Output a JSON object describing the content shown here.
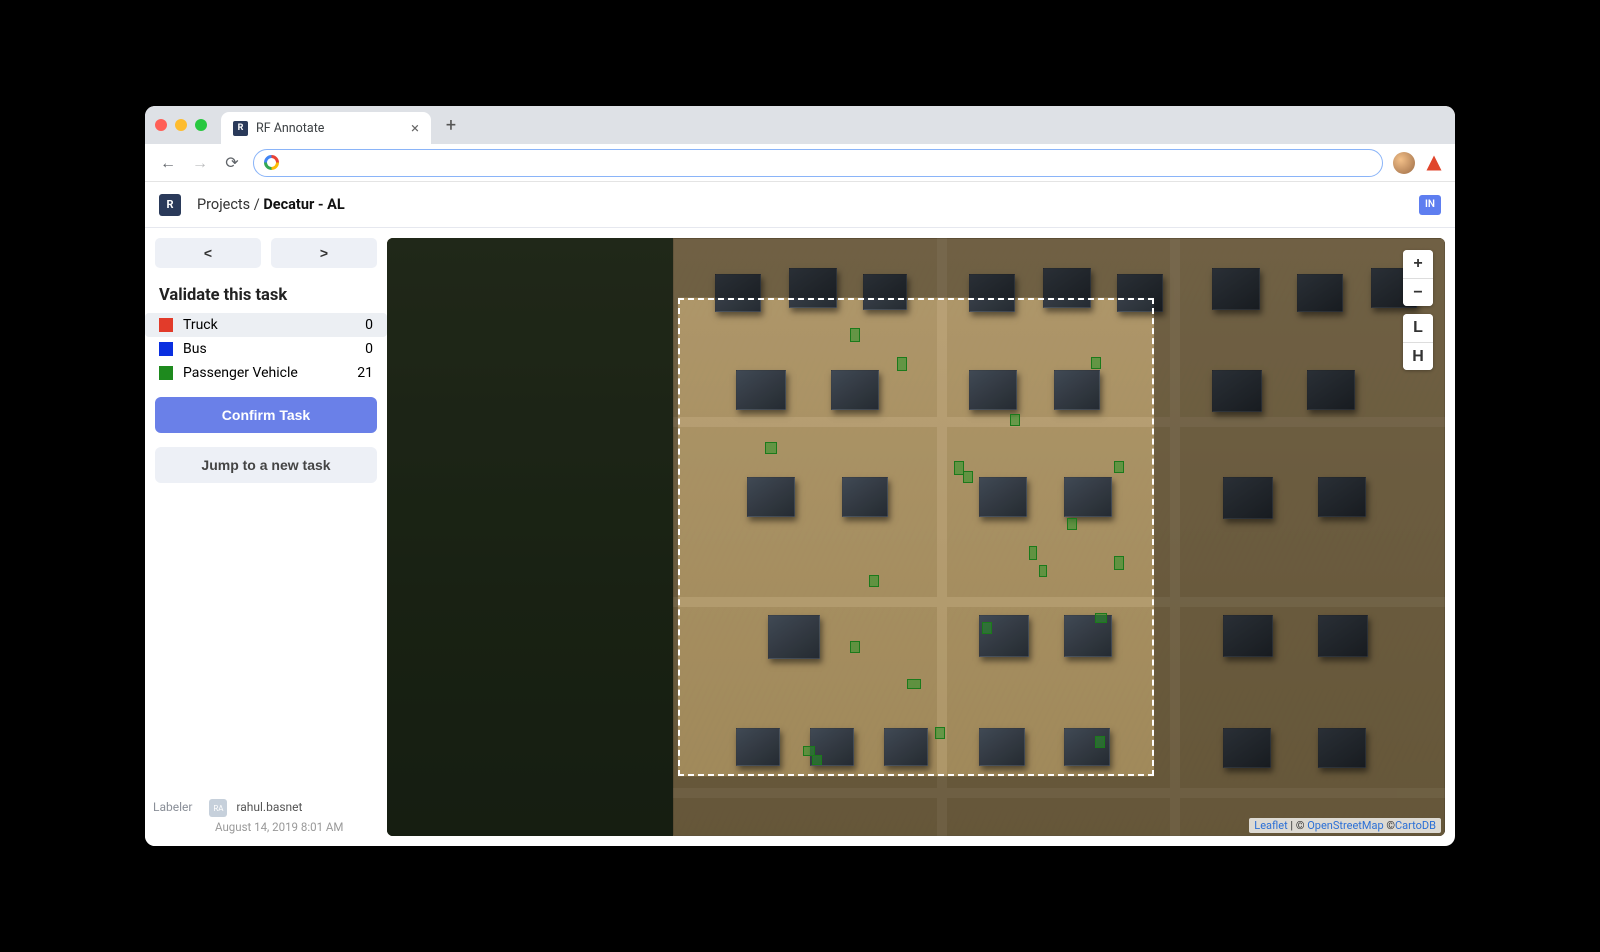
{
  "browser": {
    "tab_title": "RF Annotate",
    "tab_favicon_text": "R",
    "new_tab_glyph": "+",
    "tab_close_glyph": "×",
    "nav_back_glyph": "←",
    "nav_fwd_glyph": "→",
    "reload_glyph": "⟳"
  },
  "header": {
    "logo_text": "R",
    "breadcrumb_root": "Projects",
    "breadcrumb_sep": " / ",
    "breadcrumb_leaf": "Decatur - AL",
    "user_badge": "IN"
  },
  "sidebar": {
    "prev_glyph": "<",
    "next_glyph": ">",
    "title": "Validate this task",
    "classes": [
      {
        "name": "Truck",
        "count": 0,
        "color": "#e23b2a",
        "selected": true
      },
      {
        "name": "Bus",
        "count": 0,
        "color": "#0a2fe0",
        "selected": false
      },
      {
        "name": "Passenger Vehicle",
        "count": 21,
        "color": "#1e8a1e",
        "selected": false
      }
    ],
    "confirm_label": "Confirm Task",
    "jump_label": "Jump to a new task",
    "labeler_label": "Labeler",
    "labeler_initials": "RA",
    "labeler_user": "rahul.basnet",
    "labeler_time": "August 14, 2019 8:01 AM"
  },
  "map": {
    "zoom_in": "+",
    "zoom_out": "−",
    "btn_L": "L",
    "btn_H": "H",
    "attrib_leaflet": "Leaflet",
    "attrib_sep": " | © ",
    "attrib_osm": "OpenStreetMap",
    "attrib_sep2": " ©",
    "attrib_carto": "CartoDB"
  }
}
